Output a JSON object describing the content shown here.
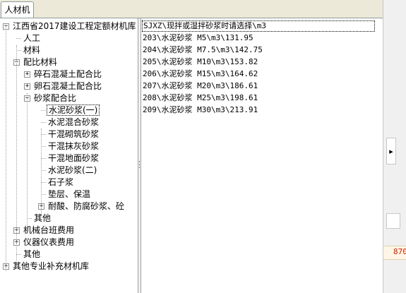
{
  "tabs": [
    {
      "label": "人材机"
    }
  ],
  "tree": [
    {
      "label": "江西省2017建设工程定额材机库",
      "expander": "−"
    },
    {
      "label": "人工"
    },
    {
      "label": "材料"
    },
    {
      "label": "配比材料",
      "expander": "−"
    },
    {
      "label": "碎石混凝土配合比",
      "expander": "+"
    },
    {
      "label": "卵石混凝土配合比",
      "expander": "+"
    },
    {
      "label": "砂浆配合比",
      "expander": "−"
    },
    {
      "label": "水泥砂浆(一)",
      "selected": true
    },
    {
      "label": "水泥混合砂浆"
    },
    {
      "label": "干混砌筑砂浆"
    },
    {
      "label": "干混抹灰砂浆"
    },
    {
      "label": "干混地面砂浆"
    },
    {
      "label": "水泥砂浆(二)"
    },
    {
      "label": "石子浆"
    },
    {
      "label": "垫层、保温"
    },
    {
      "label": "耐酸、防腐砂浆、砼",
      "expander": "+"
    },
    {
      "label": "其他"
    },
    {
      "label": "机械台班费用",
      "expander": "+"
    },
    {
      "label": "仪器仪表费用",
      "expander": "+"
    },
    {
      "label": "其他"
    },
    {
      "label": "其他专业补充材机库",
      "expander": "+"
    }
  ],
  "list": [
    {
      "text": "SJXZ\\现拌或湿拌砂浆时请选择\\m3",
      "selected": true
    },
    {
      "text": "203\\水泥砂浆 M5\\m3\\131.95"
    },
    {
      "text": "204\\水泥砂浆 M7.5\\m3\\142.75"
    },
    {
      "text": "205\\水泥砂浆 M10\\m3\\153.82"
    },
    {
      "text": "206\\水泥砂浆 M15\\m3\\164.62"
    },
    {
      "text": "207\\水泥砂浆 M20\\m3\\186.61"
    },
    {
      "text": "208\\水泥砂浆 M25\\m3\\198.61"
    },
    {
      "text": "209\\水泥砂浆 M30\\m3\\213.91"
    }
  ],
  "right_strip": {
    "button_glyph": "▸",
    "value": "870"
  }
}
